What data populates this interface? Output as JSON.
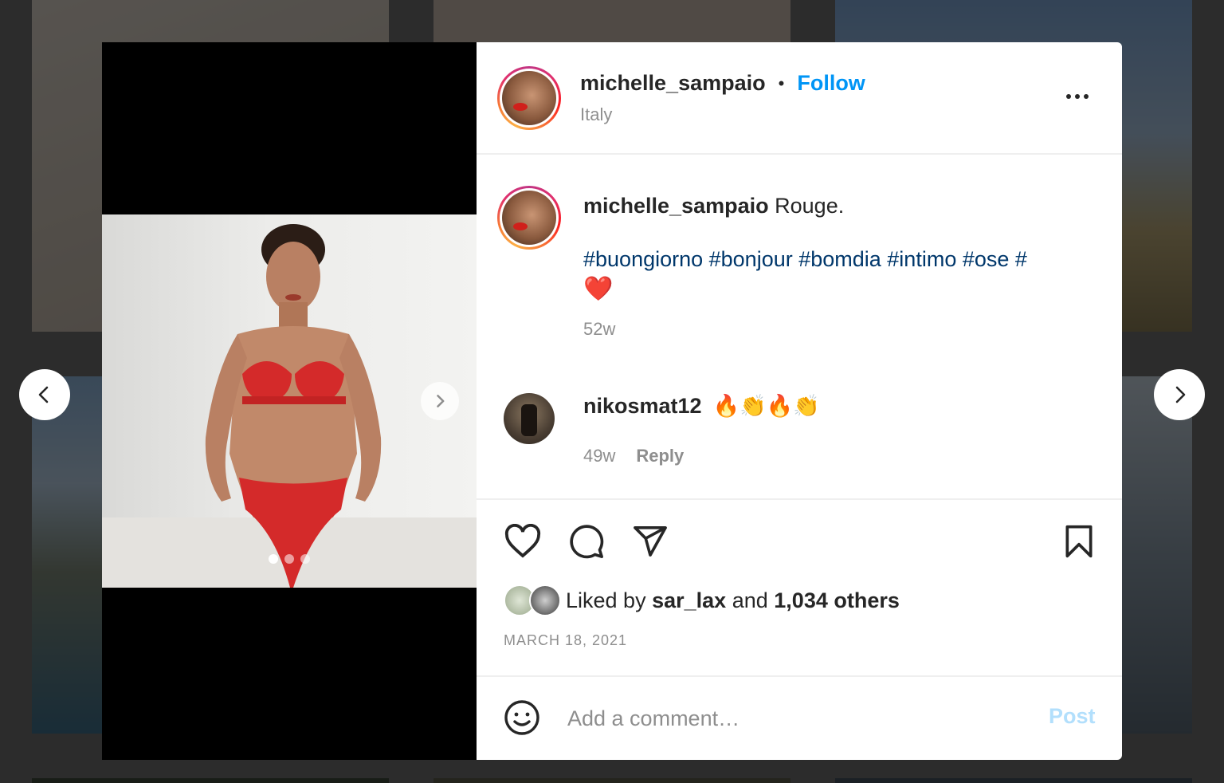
{
  "post": {
    "username": "michelle_sampaio",
    "separator": "•",
    "follow_label": "Follow",
    "location": "Italy"
  },
  "caption": {
    "username": "michelle_sampaio",
    "text": "Rouge.",
    "hashtags": "#buongiorno #bonjour #bomdia #intimo #ose #",
    "emoji": "❤️",
    "age": "52w"
  },
  "comments": [
    {
      "username": "nikosmat12",
      "text": "🔥👏🔥👏",
      "age": "49w",
      "reply_label": "Reply"
    }
  ],
  "likes": {
    "prefix": "Liked by",
    "user": "sar_lax",
    "connector": "and",
    "others": "1,034 others"
  },
  "date": "MARCH 18, 2021",
  "comment_box": {
    "placeholder": "Add a comment…",
    "post_label": "Post"
  },
  "carousel": {
    "total": 3,
    "active": 1
  },
  "colors": {
    "follow": "#0095f6",
    "hashtag": "#00376b",
    "post_disabled": "#b2dffc",
    "muted": "#8e8e8e"
  }
}
